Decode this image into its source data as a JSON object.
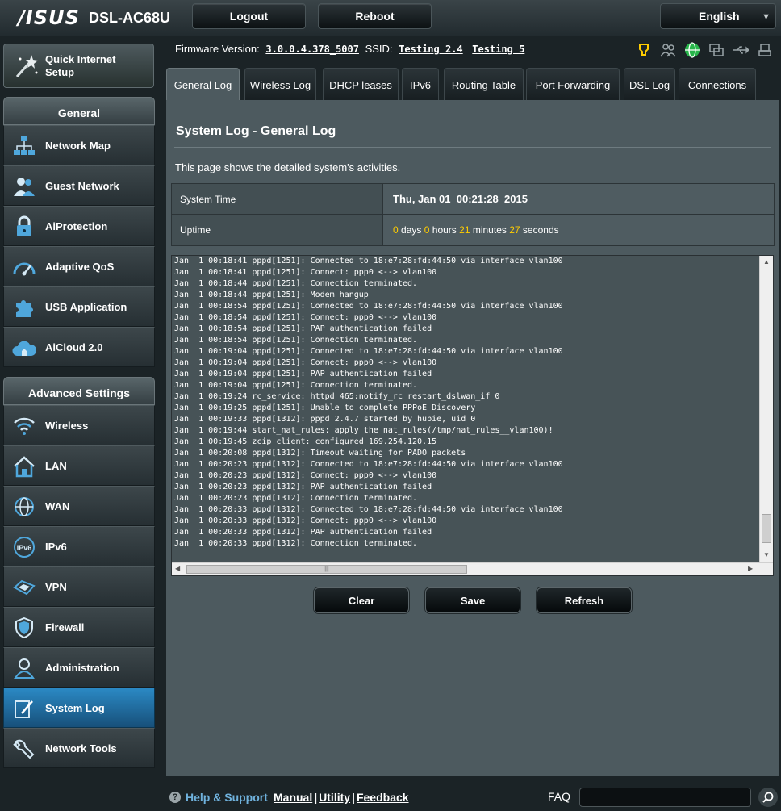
{
  "brand": {
    "logo": "/ISUS",
    "model": "DSL-AC68U"
  },
  "header": {
    "logout_label": "Logout",
    "reboot_label": "Reboot",
    "language": "English"
  },
  "quick_setup": {
    "label_line1": "Quick Internet",
    "label_line2": "Setup"
  },
  "sidebar": {
    "general_title": "General",
    "general_items": [
      {
        "label": "Network Map",
        "icon": "network-map-icon"
      },
      {
        "label": "Guest Network",
        "icon": "guest-network-icon"
      },
      {
        "label": "AiProtection",
        "icon": "lock-icon"
      },
      {
        "label": "Adaptive QoS",
        "icon": "gauge-icon"
      },
      {
        "label": "USB Application",
        "icon": "puzzle-icon"
      },
      {
        "label": "AiCloud 2.0",
        "icon": "cloud-icon"
      }
    ],
    "advanced_title": "Advanced Settings",
    "advanced_items": [
      {
        "label": "Wireless",
        "icon": "wifi-icon"
      },
      {
        "label": "LAN",
        "icon": "home-icon"
      },
      {
        "label": "WAN",
        "icon": "globe-icon"
      },
      {
        "label": "IPv6",
        "icon": "ipv6-icon"
      },
      {
        "label": "VPN",
        "icon": "vpn-icon"
      },
      {
        "label": "Firewall",
        "icon": "shield-icon"
      },
      {
        "label": "Administration",
        "icon": "admin-user-icon"
      },
      {
        "label": "System Log",
        "icon": "system-log-icon"
      },
      {
        "label": "Network Tools",
        "icon": "wrench-icon"
      }
    ]
  },
  "status_bar": {
    "firmware_label": "Firmware Version:",
    "firmware_value": "3.0.0.4.378_5007",
    "ssid_label": "SSID:",
    "ssid_1": "Testing 2.4",
    "ssid_2": "Testing 5"
  },
  "tabs": [
    {
      "label": "General Log"
    },
    {
      "label": "Wireless Log"
    },
    {
      "label": "DHCP leases"
    },
    {
      "label": "IPv6"
    },
    {
      "label": "Routing Table"
    },
    {
      "label": "Port Forwarding"
    },
    {
      "label": "DSL Log"
    },
    {
      "label": "Connections"
    }
  ],
  "page": {
    "title": "System Log - General Log",
    "description": "This page shows the detailed system's activities.",
    "system_time_label": "System Time",
    "system_time_value": "Thu, Jan 01  00:21:28  2015",
    "uptime_label": "Uptime",
    "uptime": {
      "days": "0",
      "days_unit": "days",
      "hours": "0",
      "hours_unit": "hours",
      "minutes": "21",
      "minutes_unit": "minutes",
      "seconds": "27",
      "seconds_unit": "seconds"
    },
    "log_lines": [
      "Jan  1 00:18:41 pppd[1251]: Connected to 18:e7:28:fd:44:50 via interface vlan100",
      "Jan  1 00:18:41 pppd[1251]: Connect: ppp0 <--> vlan100",
      "Jan  1 00:18:44 pppd[1251]: Connection terminated.",
      "Jan  1 00:18:44 pppd[1251]: Modem hangup",
      "Jan  1 00:18:54 pppd[1251]: Connected to 18:e7:28:fd:44:50 via interface vlan100",
      "Jan  1 00:18:54 pppd[1251]: Connect: ppp0 <--> vlan100",
      "Jan  1 00:18:54 pppd[1251]: PAP authentication failed",
      "Jan  1 00:18:54 pppd[1251]: Connection terminated.",
      "Jan  1 00:19:04 pppd[1251]: Connected to 18:e7:28:fd:44:50 via interface vlan100",
      "Jan  1 00:19:04 pppd[1251]: Connect: ppp0 <--> vlan100",
      "Jan  1 00:19:04 pppd[1251]: PAP authentication failed",
      "Jan  1 00:19:04 pppd[1251]: Connection terminated.",
      "Jan  1 00:19:24 rc_service: httpd 465:notify_rc restart_dslwan_if 0",
      "Jan  1 00:19:25 pppd[1251]: Unable to complete PPPoE Discovery",
      "Jan  1 00:19:33 pppd[1312]: pppd 2.4.7 started by hubie, uid 0",
      "Jan  1 00:19:44 start_nat_rules: apply the nat_rules(/tmp/nat_rules__vlan100)!",
      "Jan  1 00:19:45 zcip client: configured 169.254.120.15",
      "Jan  1 00:20:08 pppd[1312]: Timeout waiting for PADO packets",
      "Jan  1 00:20:23 pppd[1312]: Connected to 18:e7:28:fd:44:50 via interface vlan100",
      "Jan  1 00:20:23 pppd[1312]: Connect: ppp0 <--> vlan100",
      "Jan  1 00:20:23 pppd[1312]: PAP authentication failed",
      "Jan  1 00:20:23 pppd[1312]: Connection terminated.",
      "Jan  1 00:20:33 pppd[1312]: Connected to 18:e7:28:fd:44:50 via interface vlan100",
      "Jan  1 00:20:33 pppd[1312]: Connect: ppp0 <--> vlan100",
      "Jan  1 00:20:33 pppd[1312]: PAP authentication failed",
      "Jan  1 00:20:33 pppd[1312]: Connection terminated."
    ],
    "buttons": {
      "clear": "Clear",
      "save": "Save",
      "refresh": "Refresh"
    }
  },
  "footer": {
    "help_label": "Help & Support",
    "manual": "Manual",
    "utility": "Utility",
    "feedback": "Feedback",
    "separator": "|",
    "faq_label": "FAQ"
  },
  "colors": {
    "accent": "#2b89c4",
    "highlight_number": "#ffcc00",
    "help_link": "#6fb1dc"
  }
}
